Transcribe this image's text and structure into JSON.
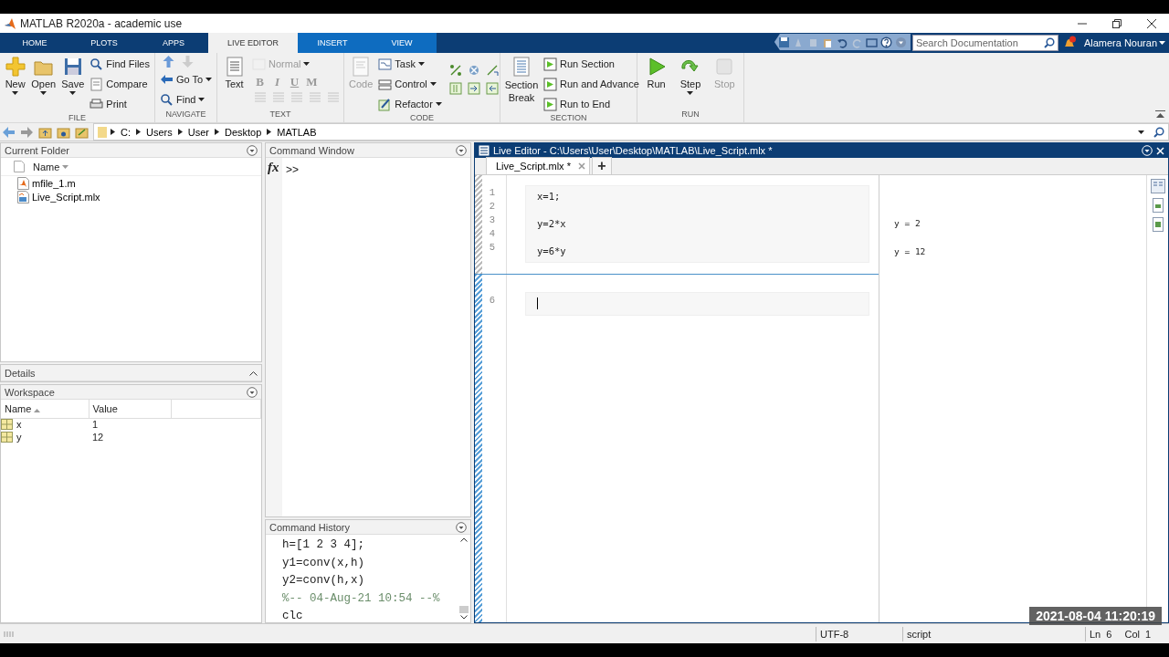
{
  "window": {
    "title": "MATLAB R2020a - academic use"
  },
  "ribbon": {
    "tabs": [
      {
        "label": "HOME",
        "selected": false,
        "kind": "standard"
      },
      {
        "label": "PLOTS",
        "selected": false,
        "kind": "standard"
      },
      {
        "label": "APPS",
        "selected": false,
        "kind": "standard"
      },
      {
        "label": "LIVE EDITOR",
        "selected": true,
        "kind": "contextual"
      },
      {
        "label": "INSERT",
        "selected": false,
        "kind": "contextual"
      },
      {
        "label": "VIEW",
        "selected": false,
        "kind": "contextual"
      }
    ],
    "search": {
      "placeholder": "Search Documentation"
    },
    "user": "Alamera Nouran",
    "sections": [
      {
        "title": "FILE",
        "items": [
          {
            "kind": "large",
            "label": "New",
            "dropdown": true,
            "disabled": false
          },
          {
            "kind": "large",
            "label": "Open",
            "dropdown": true,
            "disabled": false
          },
          {
            "kind": "large",
            "label": "Save",
            "dropdown": true,
            "disabled": false
          },
          {
            "kind": "small",
            "label": "Find Files",
            "dropdown": false,
            "disabled": false
          },
          {
            "kind": "small",
            "label": "Compare",
            "dropdown": false,
            "disabled": false
          },
          {
            "kind": "small",
            "label": "Print",
            "dropdown": false,
            "disabled": false
          }
        ]
      },
      {
        "title": "NAVIGATE",
        "items": [
          {
            "kind": "arrows"
          },
          {
            "kind": "small",
            "label": "Go To",
            "dropdown": true,
            "disabled": false
          },
          {
            "kind": "small",
            "label": "Find",
            "dropdown": true,
            "disabled": false
          }
        ]
      },
      {
        "title": "TEXT",
        "items": [
          {
            "kind": "large",
            "label": "Text",
            "dropdown": false,
            "disabled": false
          },
          {
            "kind": "small",
            "label": "Normal",
            "dropdown": true,
            "disabled": true
          },
          {
            "kind": "format",
            "letters": [
              "B",
              "I",
              "U",
              "M"
            ],
            "disabled": true
          },
          {
            "kind": "lists"
          }
        ]
      },
      {
        "title": "CODE",
        "items": [
          {
            "kind": "large",
            "label": "Code",
            "dropdown": false,
            "disabled": true
          },
          {
            "kind": "small",
            "label": "Task",
            "dropdown": true,
            "disabled": false
          },
          {
            "kind": "small",
            "label": "Control",
            "dropdown": true,
            "disabled": false
          },
          {
            "kind": "small",
            "label": "Refactor",
            "dropdown": true,
            "disabled": false
          },
          {
            "kind": "codegrid"
          }
        ]
      },
      {
        "title": "SECTION",
        "items": [
          {
            "kind": "large",
            "label": "Section Break",
            "dropdown": false,
            "disabled": false
          },
          {
            "kind": "small",
            "label": "Run Section",
            "dropdown": false,
            "disabled": false
          },
          {
            "kind": "small",
            "label": "Run and Advance",
            "dropdown": false,
            "disabled": false
          },
          {
            "kind": "small",
            "label": "Run to End",
            "dropdown": false,
            "disabled": false
          }
        ]
      },
      {
        "title": "RUN",
        "items": [
          {
            "kind": "large",
            "label": "Run",
            "dropdown": false,
            "disabled": false
          },
          {
            "kind": "large",
            "label": "Step",
            "dropdown": true,
            "disabled": false
          },
          {
            "kind": "large",
            "label": "Stop",
            "dropdown": false,
            "disabled": true
          }
        ]
      }
    ]
  },
  "address": {
    "path": [
      "C:",
      "Users",
      "User",
      "Desktop",
      "MATLAB"
    ]
  },
  "current_folder": {
    "title": "Current Folder",
    "column": "Name",
    "files": [
      {
        "name": "mfile_1.m",
        "kind": "m"
      },
      {
        "name": "Live_Script.mlx",
        "kind": "mlx"
      }
    ]
  },
  "details": {
    "title": "Details"
  },
  "workspace": {
    "title": "Workspace",
    "columns": [
      "Name",
      "Value"
    ],
    "rows": [
      {
        "name": "x",
        "value": "1"
      },
      {
        "name": "y",
        "value": "12"
      }
    ]
  },
  "command_window": {
    "title": "Command Window",
    "fx": "fx",
    "prompt": ">>"
  },
  "command_history": {
    "title": "Command History",
    "entries": [
      {
        "text": "h=[1 2 3 4];",
        "kind": "command"
      },
      {
        "text": "y1=conv(x,h)",
        "kind": "command"
      },
      {
        "text": "y2=conv(h,x)",
        "kind": "command"
      },
      {
        "text": "%-- 04-Aug-21 10:54 --%",
        "kind": "separator"
      },
      {
        "text": "clc",
        "kind": "command"
      }
    ]
  },
  "live_editor": {
    "title": "Live Editor - C:\\Users\\User\\Desktop\\MATLAB\\Live_Script.mlx *",
    "tabs": [
      {
        "label": "Live_Script.mlx *",
        "selected": true
      }
    ],
    "add_tab": "+",
    "sections": [
      {
        "lines": [
          {
            "number": "1",
            "code": "x=1;"
          },
          {
            "number": "2"
          },
          {
            "number": "3",
            "code": "y=2*x"
          },
          {
            "number": "4"
          },
          {
            "number": "5",
            "code": "y=6*y"
          }
        ]
      },
      {
        "lines": [
          {
            "number": "6"
          }
        ]
      }
    ],
    "outputs": [
      "y = 2",
      "y = 12"
    ]
  },
  "status_bar": {
    "encoding": "UTF-8",
    "file_type": "script",
    "line": "Ln  6",
    "column": "Col  1"
  },
  "overlay": {
    "timestamp": "2021-08-04 11:20:19"
  }
}
